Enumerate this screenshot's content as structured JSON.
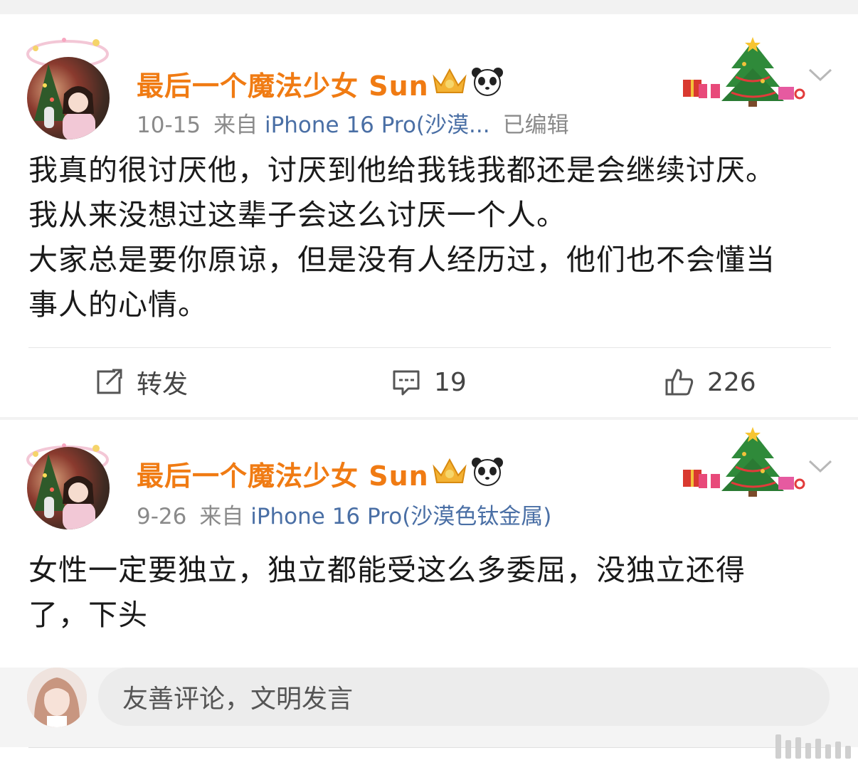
{
  "posts": [
    {
      "username": "最后一个魔法少女 Sun",
      "date": "10-15",
      "source_prefix": "来自",
      "device": "iPhone 16 Pro(沙漠...",
      "edited": "已编辑",
      "lines": [
        "我真的很讨厌他，讨厌到他给我钱我都还是会继续讨厌。",
        "我从来没想过这辈子会这么讨厌一个人。",
        "大家总是要你原谅，但是没有人经历过，他们也不会懂当",
        "事人的心情。"
      ],
      "actions": {
        "repost_label": "转发",
        "comment_count": "19",
        "like_count": "226"
      }
    },
    {
      "username": "最后一个魔法少女 Sun",
      "date": "9-26",
      "source_prefix": "来自",
      "device": "iPhone 16 Pro(沙漠色钛金属)",
      "lines": [
        "女性一定要独立，独立都能受这么多委屈，没独立还得",
        "了，下头"
      ]
    }
  ],
  "comment_box": {
    "placeholder": "友善评论，文明发言"
  },
  "icons": {
    "badges": [
      "crown-icon",
      "panda-icon"
    ],
    "decoration": "christmas-tree-icon",
    "menu": "chevron-down-icon",
    "actions": [
      "repost-icon",
      "comment-icon",
      "like-icon"
    ]
  },
  "colors": {
    "username": "#f07b13",
    "device_link": "#4a6fa5",
    "meta": "#8a8a8a",
    "body": "#1a1a1a"
  }
}
